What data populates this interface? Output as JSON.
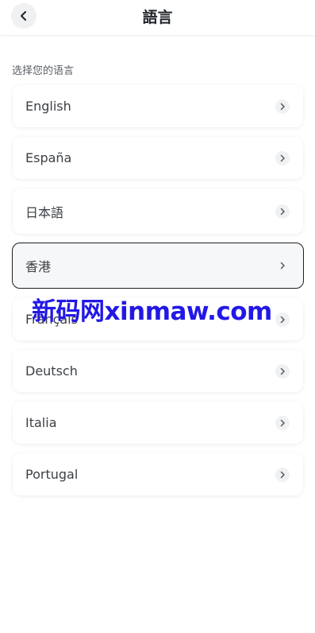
{
  "header": {
    "title": "語言",
    "back_icon": "chevron-left-icon"
  },
  "section_label": "选择您的语言",
  "languages": [
    {
      "label": "English",
      "selected": false
    },
    {
      "label": "España",
      "selected": false
    },
    {
      "label": "日本語",
      "selected": false
    },
    {
      "label": "香港",
      "selected": true
    },
    {
      "label": "Français",
      "selected": false
    },
    {
      "label": "Deutsch",
      "selected": false
    },
    {
      "label": "Italia",
      "selected": false
    },
    {
      "label": "Portugal",
      "selected": false
    }
  ],
  "item_icon": "chevron-right-icon",
  "watermark": "新码网xinmaw.com",
  "colors": {
    "selected_border": "#1d1f21",
    "watermark": "#2218e6"
  }
}
